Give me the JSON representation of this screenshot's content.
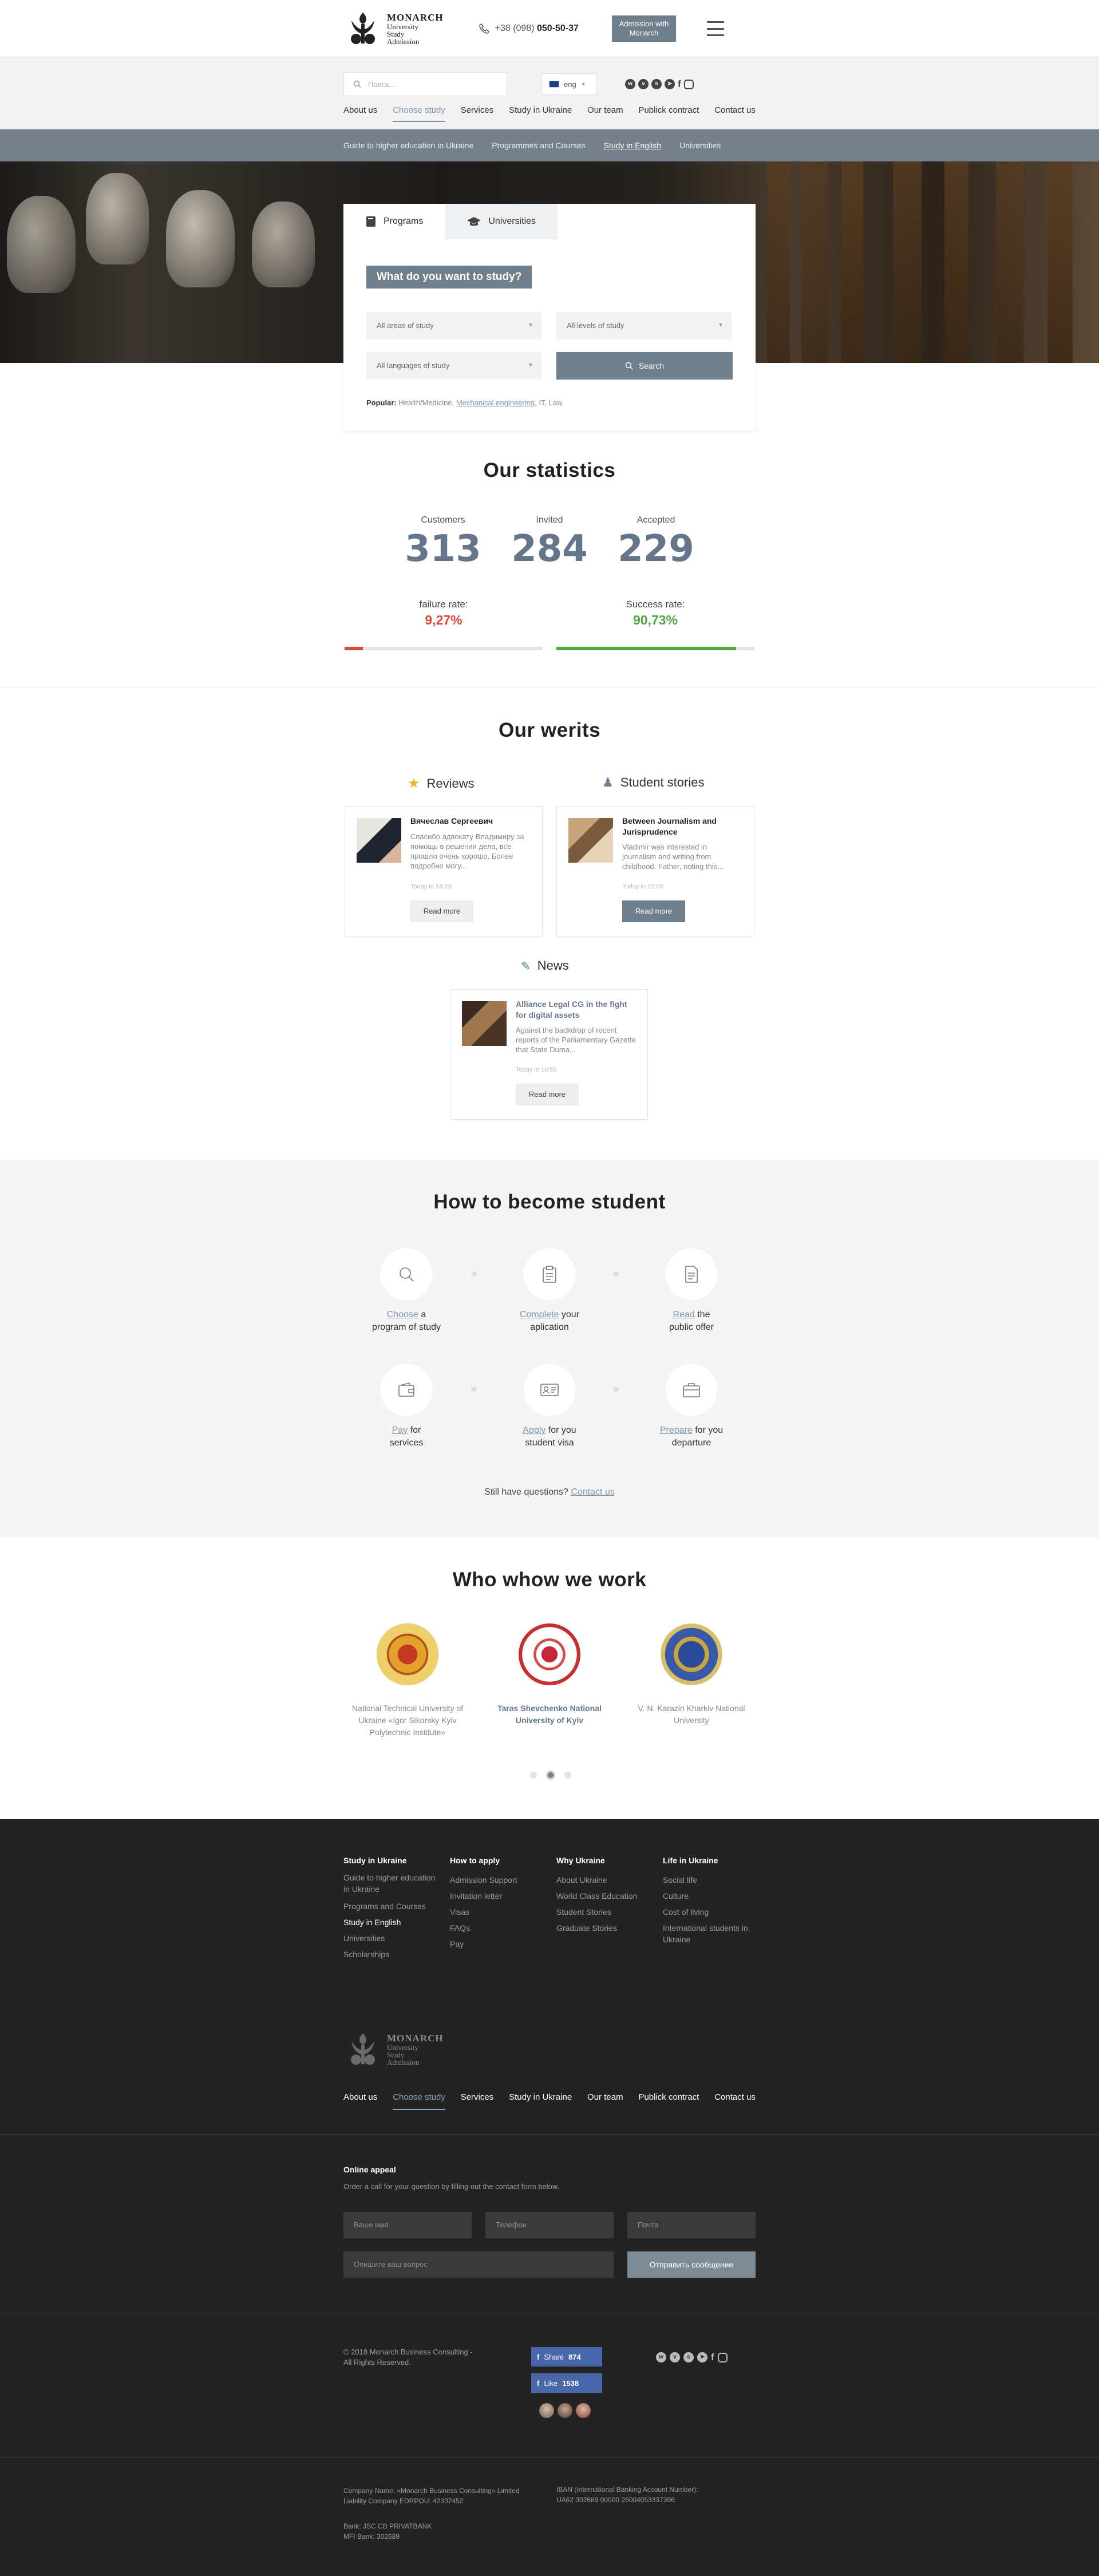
{
  "header": {
    "logo": {
      "title": "MONARCH",
      "lines": [
        "University",
        "Study",
        "Admission"
      ]
    },
    "phone_prefix": "+38 (098)",
    "phone_main": "050-50-37",
    "admission_button": "Admission with Monarch"
  },
  "search": {
    "placeholder": "Поиск..."
  },
  "language": {
    "selected": "eng"
  },
  "socials": [
    "whatsapp-icon",
    "viber-icon",
    "skype-icon",
    "telegram-icon",
    "facebook-icon",
    "instagram-icon"
  ],
  "nav": [
    "About us",
    "Choose study",
    "Services",
    "Study in Ukraine",
    "Our team",
    "Publick contract",
    "Contact us"
  ],
  "nav_active": "Choose study",
  "subnav": [
    "Guide to higher education in Ukraine",
    "Programmes and Courses",
    "Study in English",
    "Universities"
  ],
  "subnav_active": "Study in English",
  "finder": {
    "tab_programs": "Programs",
    "tab_universities": "Universities",
    "heading": "What do you want to study?",
    "area": "All areas of study",
    "level": "All levels of study",
    "language": "All languages of study",
    "search_button": "Search",
    "popular_label": "Popular:",
    "popular_items": [
      "Health/Medicine",
      "Mechanical engineering",
      "IT",
      "Law"
    ]
  },
  "statistics": {
    "title": "Our statistics",
    "customers_label": "Customers",
    "customers": "313",
    "invited_label": "Invited",
    "invited": "284",
    "accepted_label": "Accepted",
    "accepted": "229",
    "failure_label": "failure rate:",
    "failure": "9,27%",
    "failure_fraction": 0.0927,
    "success_label": "Success rate:",
    "success": "90,73%",
    "success_fraction": 0.9073,
    "colors": {
      "failure": "#d94a3a",
      "success": "#54a63e"
    }
  },
  "werits": {
    "title": "Our werits",
    "reviews_title": "Reviews",
    "stories_title": "Student stories",
    "news_title": "News",
    "review": {
      "name": "Вячеслав Сергеевич",
      "text": "Спасибо адвокату Владимиру за помощь в решении дела, все прошло очень хорошо. Более подробно могу...",
      "time": "Today in 18:23",
      "button": "Read more"
    },
    "story": {
      "name": "Between Journalism and Jurisprudence",
      "text": "Vladimir was interested in journalism and writing from childhood. Father, noting this...",
      "time": "Today in 12:00",
      "button": "Read more"
    },
    "news": {
      "name": "Alliance Legal CG in the fight for digital assets",
      "text": "Against the backdrop of recent reports of the Parliamentary Gazette that State Duma...",
      "time": "Today in 10:55",
      "button": "Read more"
    }
  },
  "become": {
    "title": "How to become student",
    "steps": [
      {
        "link": "Choose",
        "rest": " a",
        "line2": "program of study",
        "icon": "search-icon"
      },
      {
        "link": "Complete",
        "rest": " your",
        "line2": "aplication",
        "icon": "clipboard-icon"
      },
      {
        "link": "Read",
        "rest": " the",
        "line2": "public offer",
        "icon": "document-icon"
      },
      {
        "link": "Pay",
        "rest": " for",
        "line2": "services",
        "icon": "wallet-icon"
      },
      {
        "link": "Apply",
        "rest": " for you",
        "line2": "student visa",
        "icon": "id-card-icon"
      },
      {
        "link": "Prepare",
        "rest": " for you",
        "line2": "departure",
        "icon": "suitcase-icon"
      }
    ],
    "question": "Still have questions?",
    "contact_link": "Contact us"
  },
  "work": {
    "title": "Who whow we work",
    "universities": [
      "National Technical University of Ukraine «Igor Sikorsky Kyiv Polytechnic Institute»",
      "Taras Shevchenko National University of Kyiv",
      "V. N. Karazin Kharkiv National University"
    ]
  },
  "footer": {
    "col1": {
      "title": "Study in Ukraine",
      "items": [
        "Guide to higher education in Ukraine",
        "Programs and Courses",
        "Study in English",
        "Universities",
        "Scholarships"
      ]
    },
    "col2": {
      "title": "How to apply",
      "items": [
        "Admission Support",
        "Invitation letter",
        "Visas",
        "FAQs",
        "Pay"
      ]
    },
    "col3": {
      "title": "Why Ukraine",
      "items": [
        "About Ukraine",
        "World Class Education",
        "Student Stories",
        "Graduate Stories"
      ]
    },
    "col4": {
      "title": "Life in Ukraine",
      "items": [
        "Social life",
        "Culture",
        "Cost of living",
        "International students in Ukraine"
      ]
    },
    "appeal_title": "Online appeal",
    "appeal_text": "Order a call for your question by filling out the contact form below.",
    "name_placeholder": "Ваше имя",
    "phone_placeholder": "Телефон",
    "email_placeholder": "Почта",
    "question_placeholder": "Опишите ваш вопрос",
    "send_button": "Отправить сообщение",
    "copyright": "© 2018 Monarch Business Consulting - All Rights Reserved.",
    "share_label": "Share",
    "share_count": "874",
    "like_label": "Like",
    "like_count": "1538",
    "company": "Company Name: «Monarch Business Consulting» Limited Liability Company EDRPOU: 42337452",
    "bank": "Bank: JSC CB PRIVATBANK",
    "mfi": "MFI Bank: 302689",
    "iban_label": "IBAN (International Banking Account Number):",
    "iban": "UA62 302689 00000 26004053337396"
  }
}
